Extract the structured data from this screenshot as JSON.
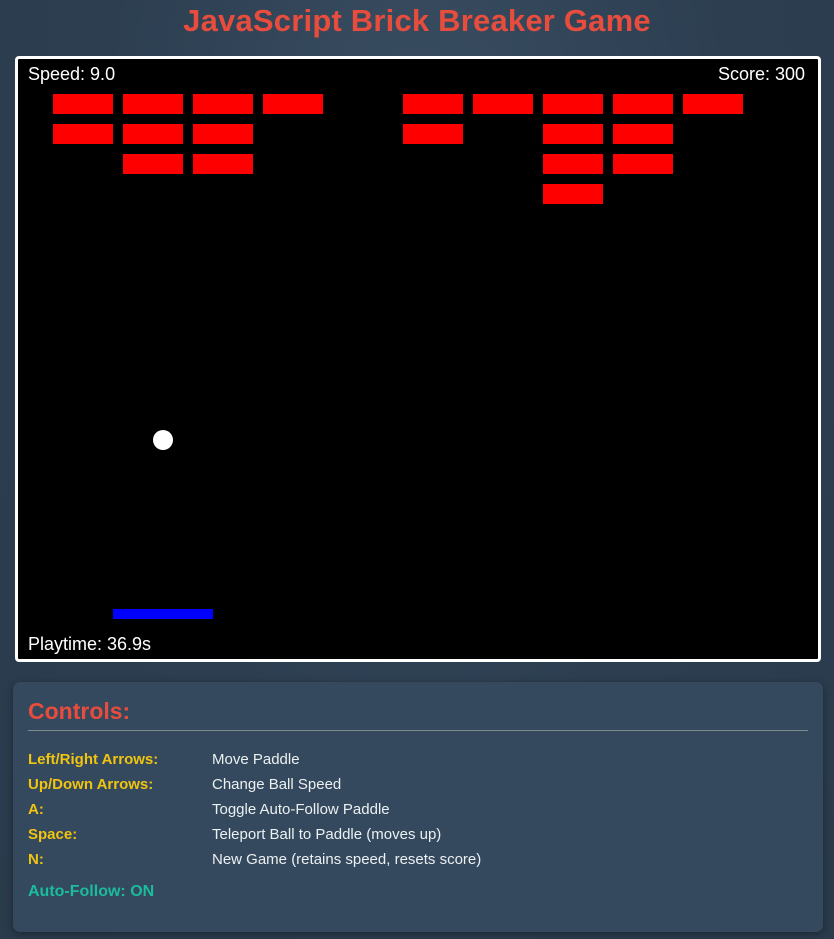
{
  "title": "JavaScript Brick Breaker Game",
  "hud": {
    "speed": "Speed: 9.0",
    "score": "Score: 300",
    "playtime": "Playtime: 36.9s"
  },
  "game": {
    "brick_rows": [
      [
        true,
        true,
        true,
        true,
        false,
        true,
        true,
        true,
        true,
        true
      ],
      [
        true,
        true,
        true,
        false,
        false,
        true,
        false,
        true,
        true,
        false
      ],
      [
        false,
        true,
        true,
        false,
        false,
        false,
        false,
        true,
        true,
        false
      ],
      [
        false,
        false,
        false,
        false,
        false,
        false,
        false,
        true,
        false,
        false
      ]
    ],
    "colors": {
      "background": "#000000",
      "brick": "#ff0000",
      "ball": "#ffffff",
      "paddle": "#0000ff",
      "border": "#ffffff"
    }
  },
  "controls": {
    "heading": "Controls:",
    "items": [
      {
        "key": "Left/Right Arrows:",
        "desc": "Move Paddle"
      },
      {
        "key": "Up/Down Arrows:",
        "desc": "Change Ball Speed"
      },
      {
        "key": "A:",
        "desc": "Toggle Auto-Follow Paddle"
      },
      {
        "key": "Space:",
        "desc": "Teleport Ball to Paddle (moves up)"
      },
      {
        "key": "N:",
        "desc": "New Game (retains speed, resets score)"
      }
    ],
    "auto_follow": "Auto-Follow: ON"
  },
  "theme": {
    "page_bg": "#2c3e50",
    "panel_bg": "#34495e",
    "title_color": "#e74c3c",
    "key_color": "#f1c40f",
    "desc_color": "#ecf0f1",
    "status_color": "#1abc9c"
  }
}
